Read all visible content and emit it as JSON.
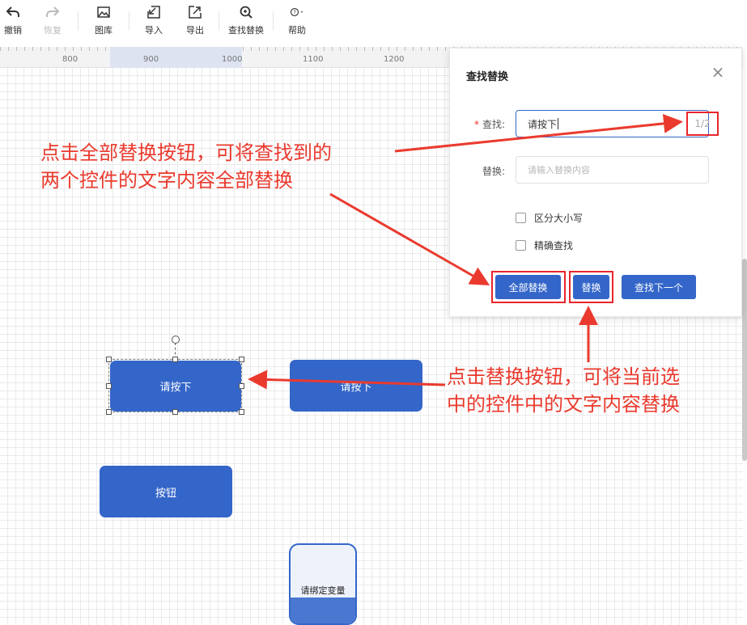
{
  "toolbar": {
    "items": [
      {
        "label": "撤销",
        "icon": "undo-icon"
      },
      {
        "label": "恢复",
        "icon": "redo-icon"
      },
      {
        "label": "图库",
        "icon": "image-icon"
      },
      {
        "label": "导入",
        "icon": "import-icon"
      },
      {
        "label": "导出",
        "icon": "export-icon"
      },
      {
        "label": "查找替换",
        "icon": "find-replace-icon"
      },
      {
        "label": "帮助",
        "icon": "help-icon"
      }
    ]
  },
  "ruler": {
    "ticks": [
      "800",
      "900",
      "1000",
      "1100",
      "1200"
    ]
  },
  "canvas": {
    "nodes": {
      "selected": "请按下",
      "second": "请按下",
      "button": "按钮",
      "bind": "请绑定变量"
    }
  },
  "dialog": {
    "title": "查找替换",
    "find_label": "查找:",
    "find_required_mark": "*",
    "find_value": "请按下",
    "match_count": "1/2",
    "replace_label": "替换:",
    "replace_placeholder": "请输入替换内容",
    "case_sensitive_label": "区分大小写",
    "exact_match_label": "精确查找",
    "replace_all_label": "全部替换",
    "replace_label_btn": "替换",
    "find_next_label": "查找下一个"
  },
  "annotations": {
    "top_line1": "点击全部替换按钮，可将查找到的",
    "top_line2": "两个控件的文字内容全部替换",
    "bottom_line1": "点击替换按钮，可将当前选",
    "bottom_line2": "中的控件中的文字内容替换"
  },
  "colors": {
    "primary": "#3466c9",
    "annotation": "#ea3a2e"
  }
}
